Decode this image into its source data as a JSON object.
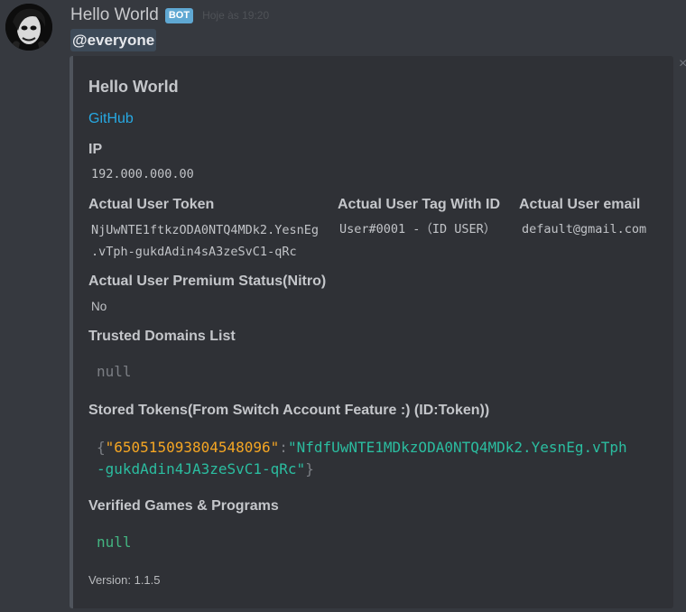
{
  "message": {
    "username": "Hello World",
    "bot_tag": "BOT",
    "timestamp": "Hoje às 19:20",
    "mention": "@everyone"
  },
  "embed": {
    "title": "Hello World",
    "link": "GitHub",
    "close_icon": "×",
    "fields": {
      "ip": {
        "name": "IP",
        "value": "192.000.000.00"
      },
      "token": {
        "name": "Actual User Token",
        "value_line1": "NjUwNTE1ftkzODA0NTQ4MDk2.YesnEg",
        "value_line2": ".vTph-gukdAdin4sA3zeSvC1-qRc"
      },
      "tag": {
        "name": "Actual User Tag With ID",
        "value": "User#0001 -（ID USER）"
      },
      "email": {
        "name": "Actual User email",
        "value": "default@gmail.com"
      },
      "premium": {
        "name": "Actual User Premium Status(Nitro)",
        "value": "No"
      },
      "trusted": {
        "name": "Trusted Domains List",
        "value": "null"
      },
      "stored": {
        "name": "Stored Tokens(From Switch Account Feature :) (ID:Token))",
        "open_brace": "{",
        "key": "\"650515093804548096\"",
        "colon": ":",
        "value_line1": "\"NfdfUwNTE1MDkzODA0NTQ4MDk2.YesnEg.vTph",
        "value_line2": "-gukdAdin4JA3zeSvC1-qRc\"",
        "close_brace": "}"
      },
      "games": {
        "name": "Verified Games & Programs",
        "value": "null"
      }
    },
    "footer": "Version: 1.1.5"
  },
  "colors": {
    "background": "#36393f",
    "embed_bg": "#2f3136",
    "link": "#27a9e3",
    "bot_tag": "#5fa8d3",
    "json_key": "#f5a623",
    "json_value": "#2bbda0",
    "green_null": "#43b581"
  }
}
